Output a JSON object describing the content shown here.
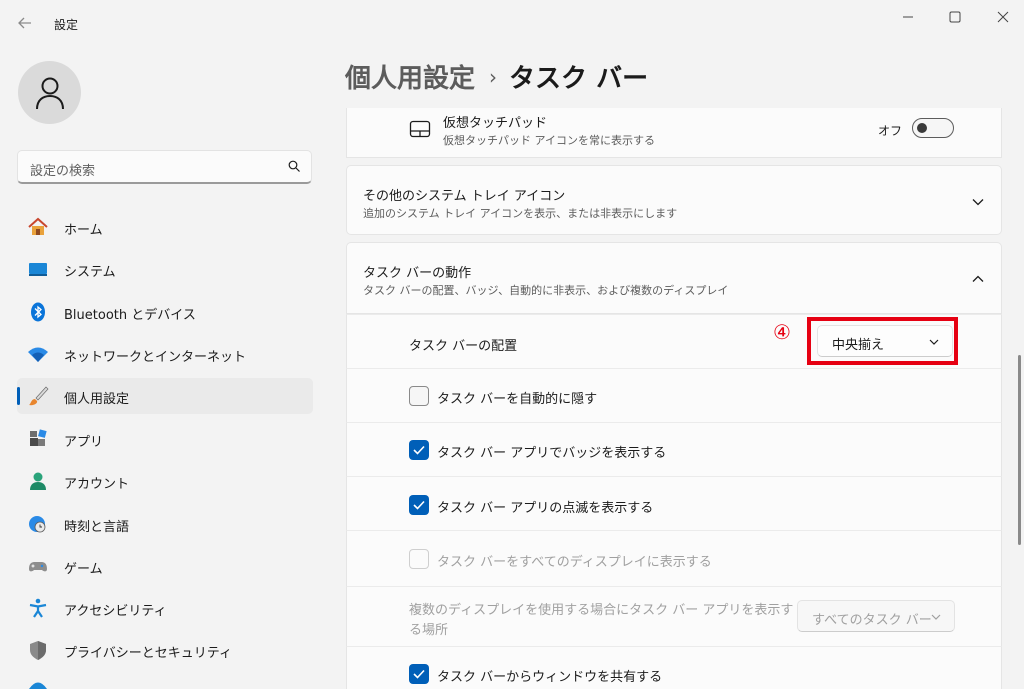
{
  "titlebar": {
    "app_title": "設定"
  },
  "sidebar": {
    "search_placeholder": "設定の検索",
    "items": [
      {
        "label": "ホーム",
        "icon": "home-icon"
      },
      {
        "label": "システム",
        "icon": "system-icon"
      },
      {
        "label": "Bluetooth とデバイス",
        "icon": "bluetooth-icon"
      },
      {
        "label": "ネットワークとインターネット",
        "icon": "wifi-icon"
      },
      {
        "label": "個人用設定",
        "icon": "personalization-brush-icon",
        "selected": true
      },
      {
        "label": "アプリ",
        "icon": "apps-icon"
      },
      {
        "label": "アカウント",
        "icon": "account-icon"
      },
      {
        "label": "時刻と言語",
        "icon": "time-language-icon"
      },
      {
        "label": "ゲーム",
        "icon": "gaming-icon"
      },
      {
        "label": "アクセシビリティ",
        "icon": "accessibility-icon"
      },
      {
        "label": "プライバシーとセキュリティ",
        "icon": "shield-icon"
      }
    ]
  },
  "breadcrumb": {
    "parent": "個人用設定",
    "separator": "›",
    "current": "タスク バー"
  },
  "touchpad": {
    "title": "仮想タッチパッド",
    "desc": "仮想タッチパッド アイコンを常に表示する",
    "state": "オフ"
  },
  "other_tray": {
    "title": "その他のシステム トレイ アイコン",
    "desc": "追加のシステム トレイ アイコンを表示、または非表示にします"
  },
  "behaviors": {
    "title": "タスク バーの動作",
    "desc": "タスク バーの配置、バッジ、自動的に非表示、および複数のディスプレイ",
    "alignment_label": "タスク バーの配置",
    "alignment_value": "中央揃え",
    "step_marker": "④",
    "auto_hide": "タスク バーを自動的に隠す",
    "badges": "タスク バー アプリでバッジを表示する",
    "flashing": "タスク バー アプリの点滅を表示する",
    "all_displays": "タスク バーをすべてのディスプレイに表示する",
    "multi_display_label_1": "複数のディスプレイを使用する場合にタスク バー アプリを表示す",
    "multi_display_label_2": "る場所",
    "multi_display_value": "すべてのタスク バー",
    "share_window": "タスク バーからウィンドウを共有する"
  },
  "colors": {
    "accent": "#005fb8",
    "highlight": "#e60012"
  }
}
